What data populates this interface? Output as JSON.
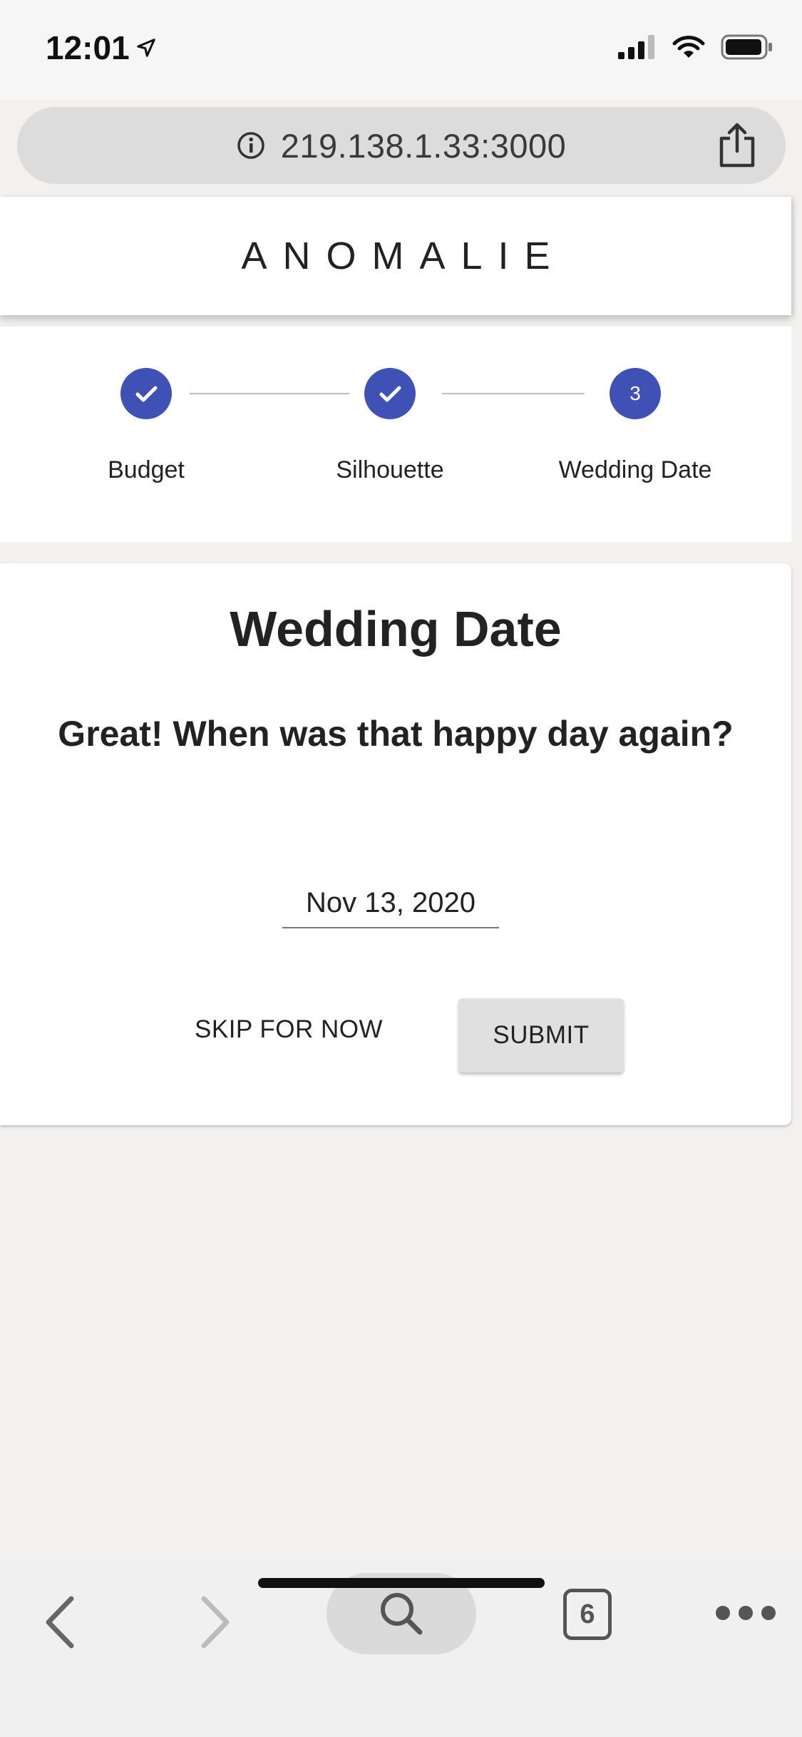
{
  "status_bar": {
    "time": "12:01",
    "location_icon": "location-arrow-icon",
    "signal_icon": "cellular-signal-icon",
    "wifi_icon": "wifi-icon",
    "battery_icon": "battery-icon"
  },
  "browser": {
    "url": "219.138.1.33:3000",
    "info_icon": "info-icon",
    "share_icon": "share-icon",
    "tab_count": "6"
  },
  "header": {
    "brand": "ANOMALIE"
  },
  "stepper": {
    "accent_color": "#3f51b5",
    "steps": [
      {
        "label": "Budget",
        "state": "completed"
      },
      {
        "label": "Silhouette",
        "state": "completed"
      },
      {
        "label": "Wedding Date",
        "state": "active",
        "number": "3"
      }
    ]
  },
  "card": {
    "title": "Wedding Date",
    "question": "Great! When was that happy day again?",
    "date_value": "Nov 13, 2020",
    "skip_label": "SKIP FOR NOW",
    "submit_label": "SUBMIT"
  }
}
